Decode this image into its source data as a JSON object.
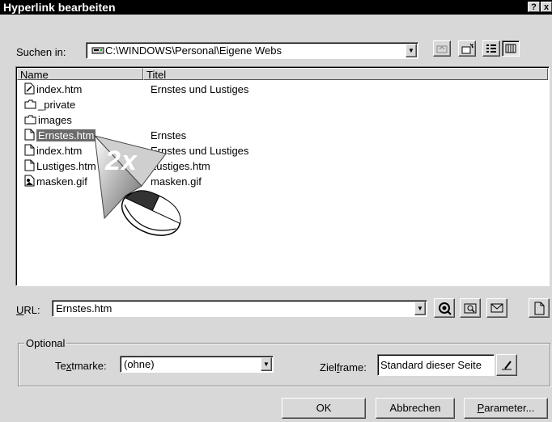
{
  "window": {
    "title": "Hyperlink bearbeiten",
    "help_button": "?",
    "close_button": "x"
  },
  "lookin": {
    "label": "Suchen in:",
    "path": "C:\\WINDOWS\\Personal\\Eigene Webs"
  },
  "list": {
    "columns": [
      "Name",
      "Titel"
    ],
    "rows": [
      {
        "name": "index.htm",
        "title": "Ernstes und Lustiges",
        "icon": "html-file-icon",
        "selected": false
      },
      {
        "name": "_private",
        "title": "",
        "icon": "folder-icon",
        "selected": false
      },
      {
        "name": "images",
        "title": "",
        "icon": "folder-icon",
        "selected": false
      },
      {
        "name": "Ernstes.htm",
        "title": "Ernstes",
        "icon": "document-icon",
        "selected": true
      },
      {
        "name": "index.htm",
        "title": "Ernstes und Lustiges",
        "icon": "document-icon",
        "selected": false
      },
      {
        "name": "Lustiges.htm",
        "title": "Lustiges.htm",
        "icon": "document-icon",
        "selected": false
      },
      {
        "name": "masken.gif",
        "title": "masken.gif",
        "icon": "image-file-icon",
        "selected": false
      }
    ]
  },
  "overlay": {
    "label": "2x"
  },
  "url": {
    "label": "URL:",
    "value": "Ernstes.htm"
  },
  "optional": {
    "legend": "Optional",
    "textmarke_label": "Textmarke:",
    "textmarke_value": "(ohne)",
    "zielframe_label": "Zielframe:",
    "zielframe_value": "Standard dieser Seite"
  },
  "buttons": {
    "ok": "OK",
    "cancel": "Abbrechen",
    "params": "Parameter..."
  }
}
